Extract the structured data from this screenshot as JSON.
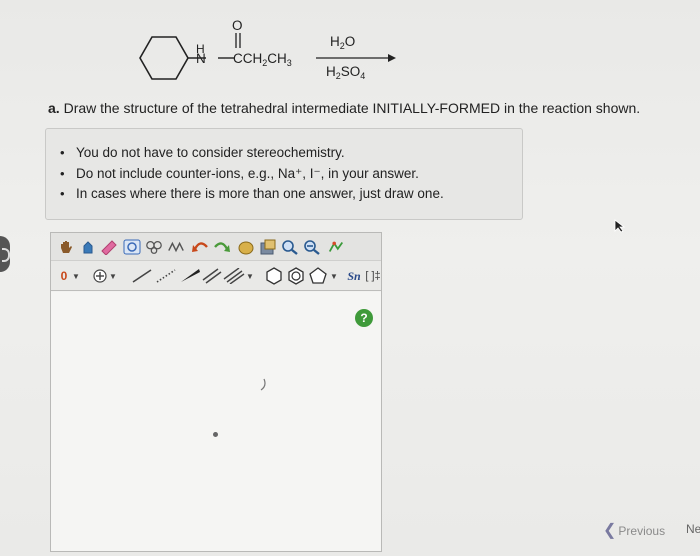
{
  "scheme": {
    "reactant_h": "H",
    "reactant_n": "N",
    "reactant_o": "O",
    "reactant_chain": "C",
    "reactant_chain2": "CH",
    "reactant_sub2": "2",
    "reactant_ch3": "CH",
    "reactant_sub3": "3",
    "reagent_top": "H",
    "reagent_top_sub": "2",
    "reagent_top_end": "O",
    "reagent_bottom": "H",
    "reagent_bottom_sub": "2",
    "reagent_bottom_mid": "SO",
    "reagent_bottom_sub2": "4"
  },
  "question": {
    "label": "a.",
    "text": " Draw the structure of the tetrahedral intermediate INITIALLY-FORMED in the reaction shown."
  },
  "hints": [
    "You do not have to consider stereochemistry.",
    "Do not include counter-ions, e.g., Na⁺, I⁻, in your answer.",
    "In cases where there is more than one answer, just draw one."
  ],
  "editor": {
    "charge_value": "0",
    "help_label": "?",
    "bracket_label": "[ ]‡",
    "sn_label": "Sn"
  },
  "nav": {
    "previous_label": "Previous",
    "next_label": "Ne"
  },
  "colors": {
    "help_green": "#3f9a3a",
    "accent_blue": "#5a7fc0"
  }
}
